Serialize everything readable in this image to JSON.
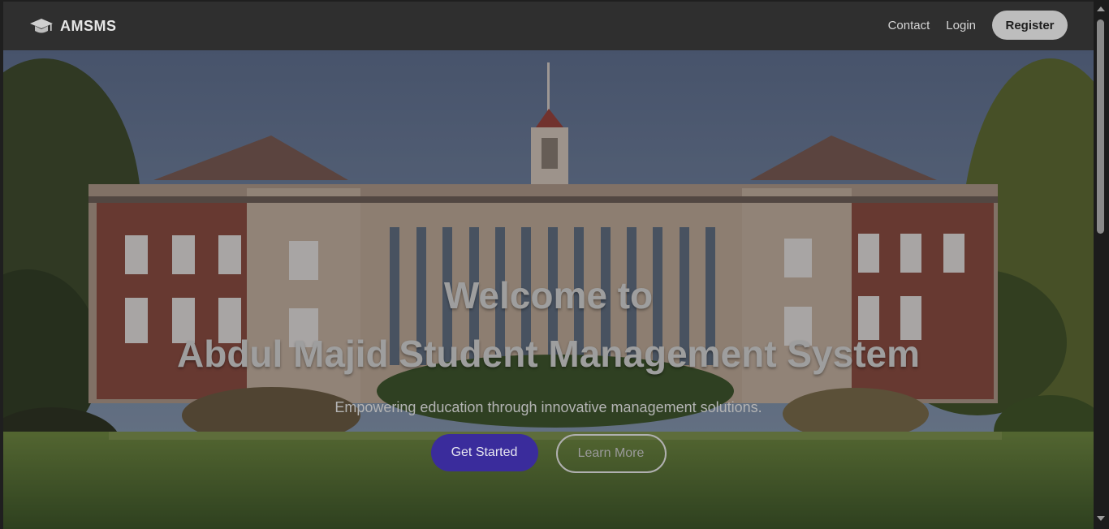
{
  "brand": {
    "name": "AMSMS",
    "icon": "graduation-cap-icon"
  },
  "nav": {
    "links": [
      {
        "label": "Contact"
      },
      {
        "label": "Login"
      }
    ],
    "register_label": "Register"
  },
  "hero": {
    "title_line1": "Welcome to",
    "title_line2": "Abdul Majid Student Management System",
    "subtitle": "Empowering education through innovative management solutions.",
    "primary_label": "Get Started",
    "secondary_label": "Learn More"
  },
  "colors": {
    "navbar": "#2f2f2f",
    "primary_button": "#3a2c9c",
    "register_button": "#bdbdbd"
  }
}
